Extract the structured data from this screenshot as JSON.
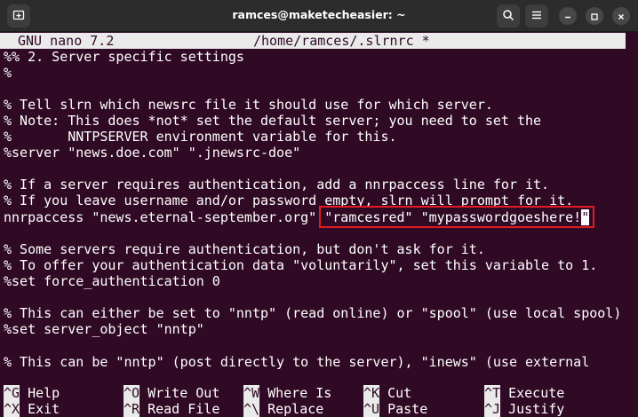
{
  "window": {
    "title": "ramces@maketecheasier: ~",
    "new_tab_icon": "new-tab-icon",
    "search_icon": "search-icon",
    "menu_icon": "hamburger-menu-icon",
    "minimize_icon": "minimize-icon",
    "maximize_icon": "maximize-icon",
    "close_icon": "close-icon"
  },
  "editor": {
    "app_version": "GNU nano 7.2",
    "file_path": "/home/ramces/.slrnrc *",
    "lines": [
      "%% 2. Server specific settings",
      "%",
      "",
      "% Tell slrn which newsrc file it should use for which server.",
      "% Note: This does *not* set the default server; you need to set the",
      "%       NNTPSERVER environment variable for this.",
      "%server \"news.doe.com\" \".jnewsrc-doe\"",
      "",
      "% If a server requires authentication, add a nnrpaccess line for it.",
      "% If you leave username and/or password empty, slrn will prompt for it.",
      "nnrpaccess \"news.eternal-september.org\" \"ramcesred\" \"mypasswordgoeshere!",
      "",
      "% Some servers require authentication, but don't ask for it.",
      "% To offer your authentication data \"voluntarily\", set this variable to 1.",
      "%set force_authentication 0",
      "",
      "% This can either be set to \"nntp\" (read online) or \"spool\" (use local spool)",
      "%set server_object \"nntp\"",
      "",
      "% This can be \"nntp\" (post directly to the server), \"inews\" (use external"
    ],
    "cursor_char": "\""
  },
  "shortcuts": [
    {
      "key": "^G",
      "label": "Help"
    },
    {
      "key": "^O",
      "label": "Write Out"
    },
    {
      "key": "^W",
      "label": "Where Is"
    },
    {
      "key": "^K",
      "label": "Cut"
    },
    {
      "key": "^T",
      "label": "Execute"
    },
    {
      "key": "^X",
      "label": "Exit"
    },
    {
      "key": "^R",
      "label": "Read File"
    },
    {
      "key": "^\\",
      "label": "Replace"
    },
    {
      "key": "^U",
      "label": "Paste"
    },
    {
      "key": "^J",
      "label": "Justify"
    }
  ],
  "colors": {
    "terminal_bg": "#300a24",
    "highlight_border": "#e01b24"
  }
}
